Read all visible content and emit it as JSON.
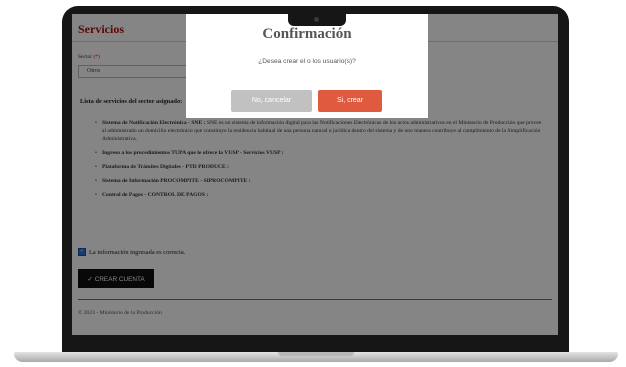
{
  "page": {
    "title": "Servicios",
    "sector": {
      "label": "Sector",
      "required_mark": "(*)",
      "selected_value": "Otros"
    },
    "list_heading": "Lista de servicios del sector asignado:",
    "services": [
      {
        "name": "Sistema de Notificación Electrónica - SNE :",
        "description": "SNE es un sistema de información digital para las Notificaciones Electrónicas de los actos administrativos en el Ministerio de Producción que provee al administrado un domicilio electrónico que constituye la residencia habitual de una persona natural o jurídica dentro del sistema y de uno manera contribuye al cumplimiento de la Simplificación Administrativa."
      },
      {
        "name": "Ingreso a los procedimientos TUPA que le ofrece la VUSP - Servicios VUSP :",
        "description": ""
      },
      {
        "name": "Plataforma de Trámites Digitales - PTD PRODUCE :",
        "description": ""
      },
      {
        "name": "Sistema de Información PROCOMPITE - SIPROCOMPITE :",
        "description": ""
      },
      {
        "name": "Control de Pagos - CONTROL DE PAGOS :",
        "description": ""
      }
    ],
    "confirmation_label": "La información ingresada es correcta.",
    "create_button": "CREAR CUENTA",
    "footer": "© 2023 - Ministerio de la Producción"
  },
  "modal": {
    "title": "Confirmación",
    "message": "¿Desea crear el o los usuario(s)?",
    "cancel_label": "No, cancelar",
    "confirm_label": "Si, crear"
  },
  "colors": {
    "title_red": "#b01212",
    "confirm_button": "#e05a40",
    "cancel_button": "#c1c1c1",
    "overlay": "rgba(0,0,0,0.48)"
  }
}
